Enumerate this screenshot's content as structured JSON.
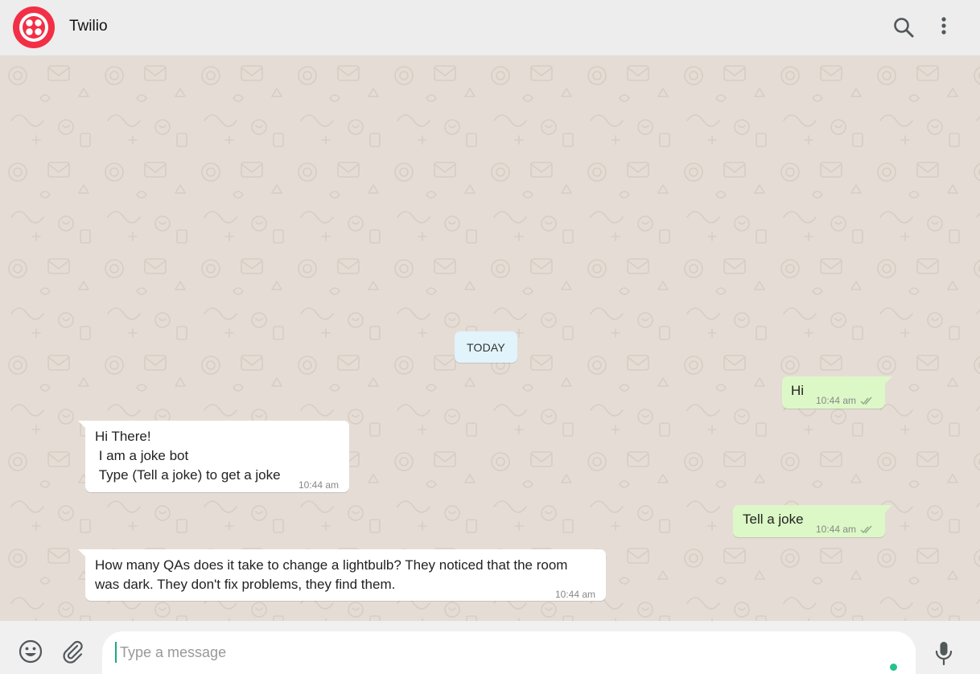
{
  "header": {
    "contact_name": "Twilio",
    "avatar_color": "#f22f46"
  },
  "chat": {
    "date_label": "TODAY",
    "messages": [
      {
        "direction": "out",
        "text": "Hi",
        "time": "10:44 am",
        "status": "read"
      },
      {
        "direction": "in",
        "text": "Hi There!\n I am a joke bot\n Type (Tell a joke) to get a joke",
        "time": "10:44 am"
      },
      {
        "direction": "out",
        "text": "Tell a joke",
        "time": "10:44 am",
        "status": "read"
      },
      {
        "direction": "in",
        "text": "How many QAs does it take to change a lightbulb? They noticed that the room\nwas dark. They don't fix problems, they find them.",
        "time": "10:44 am"
      }
    ]
  },
  "composer": {
    "placeholder": "Type a message"
  },
  "icons": {
    "search": "search-icon",
    "menu": "more-vertical-icon",
    "emoji": "emoji-icon",
    "attach": "paperclip-icon",
    "mic": "microphone-icon",
    "ticks": "double-check-icon"
  },
  "colors": {
    "header_bg": "#ededed",
    "chat_bg": "#e5ddd5",
    "incoming_bubble": "#ffffff",
    "outgoing_bubble": "#dcf8c6",
    "date_chip": "#e1f3fb",
    "online": "#25c28e"
  }
}
